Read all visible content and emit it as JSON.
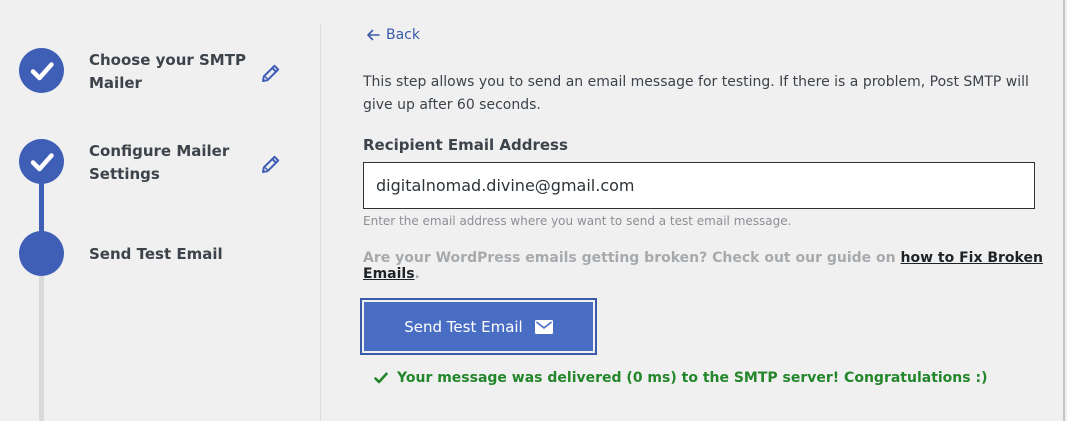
{
  "steps": [
    {
      "label": "Choose your SMTP Mailer",
      "status": "complete"
    },
    {
      "label": "Configure Mailer Settings",
      "status": "complete"
    },
    {
      "label": "Send Test Email",
      "status": "current"
    }
  ],
  "back": {
    "label": "Back"
  },
  "description": "This step allows you to send an email message for testing. If there is a problem, Post SMTP will give up after 60 seconds.",
  "recipient": {
    "label": "Recipient Email Address",
    "value": "digitalnomad.divine@gmail.com",
    "hint": "Enter the email address where you want to send a test email message."
  },
  "broken_notice": {
    "text": "Are your WordPress emails getting broken? Check out our guide on ",
    "link_text": "how to Fix Broken Emails",
    "suffix": "."
  },
  "send_button": {
    "label": "Send Test Email"
  },
  "success_message": "Your message was delivered (0 ms) to the SMTP server! Congratulations :)",
  "colors": {
    "accent": "#3f5eb6",
    "button": "#4a6dc4",
    "success": "#23862a",
    "link": "#3a5aaa"
  },
  "icons": {
    "check": "check-icon",
    "edit": "pencil-icon",
    "back": "arrow-left-icon",
    "mail": "envelope-icon",
    "success": "checkmark-icon"
  }
}
